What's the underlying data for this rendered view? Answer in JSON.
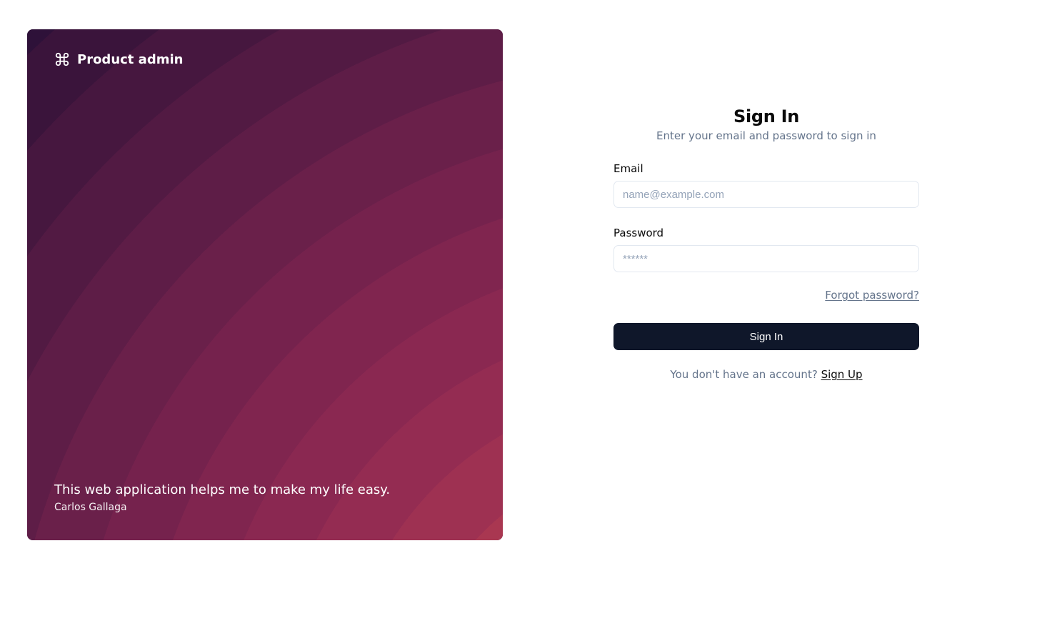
{
  "brand": {
    "name": "Product admin"
  },
  "quote": {
    "text": "This web application helps me to make my life easy.",
    "author": "Carlos Gallaga"
  },
  "form": {
    "title": "Sign In",
    "subtitle": "Enter your email and password to sign in",
    "email": {
      "label": "Email",
      "placeholder": "name@example.com",
      "value": ""
    },
    "password": {
      "label": "Password",
      "placeholder": "******",
      "value": ""
    },
    "forgot_label": "Forgot password?",
    "submit_label": "Sign In",
    "signup_prompt": "You don't have an account? ",
    "signup_link": "Sign Up"
  }
}
